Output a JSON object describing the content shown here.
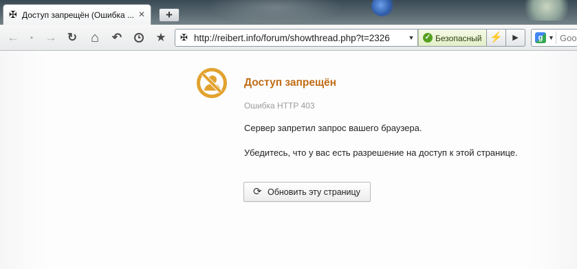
{
  "colors": {
    "title": "#c06c15",
    "secure_bg": "#e3efc8",
    "icon": "#e2a230"
  },
  "tab": {
    "title": "Доступ запрещён (Ошибка ...",
    "favicon": "cross-pattee-icon",
    "close": "✕"
  },
  "new_tab_label": "+",
  "toolbar": {
    "back_icon": "←",
    "dot_icon": "•",
    "forward_icon": "→",
    "reload_icon": "↻",
    "home_icon": "⌂",
    "undo_icon": "↶",
    "history_icon": "clock-icon",
    "bookmark_icon": "★"
  },
  "omnibox": {
    "url": "http://reibert.info/forum/showthread.php?t=2326",
    "dropdown": "▼"
  },
  "security": {
    "label": "Безопасный"
  },
  "extensions": {
    "bolt": "⚡",
    "play": "▶"
  },
  "search": {
    "engine": "google-icon",
    "logo_letter": "g",
    "placeholder": "Goo",
    "dropdown": "▼"
  },
  "error": {
    "title": "Доступ запрещён",
    "code": "Ошибка HTTP 403",
    "message1": "Сервер запретил запрос вашего браузера.",
    "message2": "Убедитесь, что у вас есть разрешение на доступ к этой странице.",
    "reload_label": "Обновить эту страницу",
    "reload_icon": "⟳"
  }
}
